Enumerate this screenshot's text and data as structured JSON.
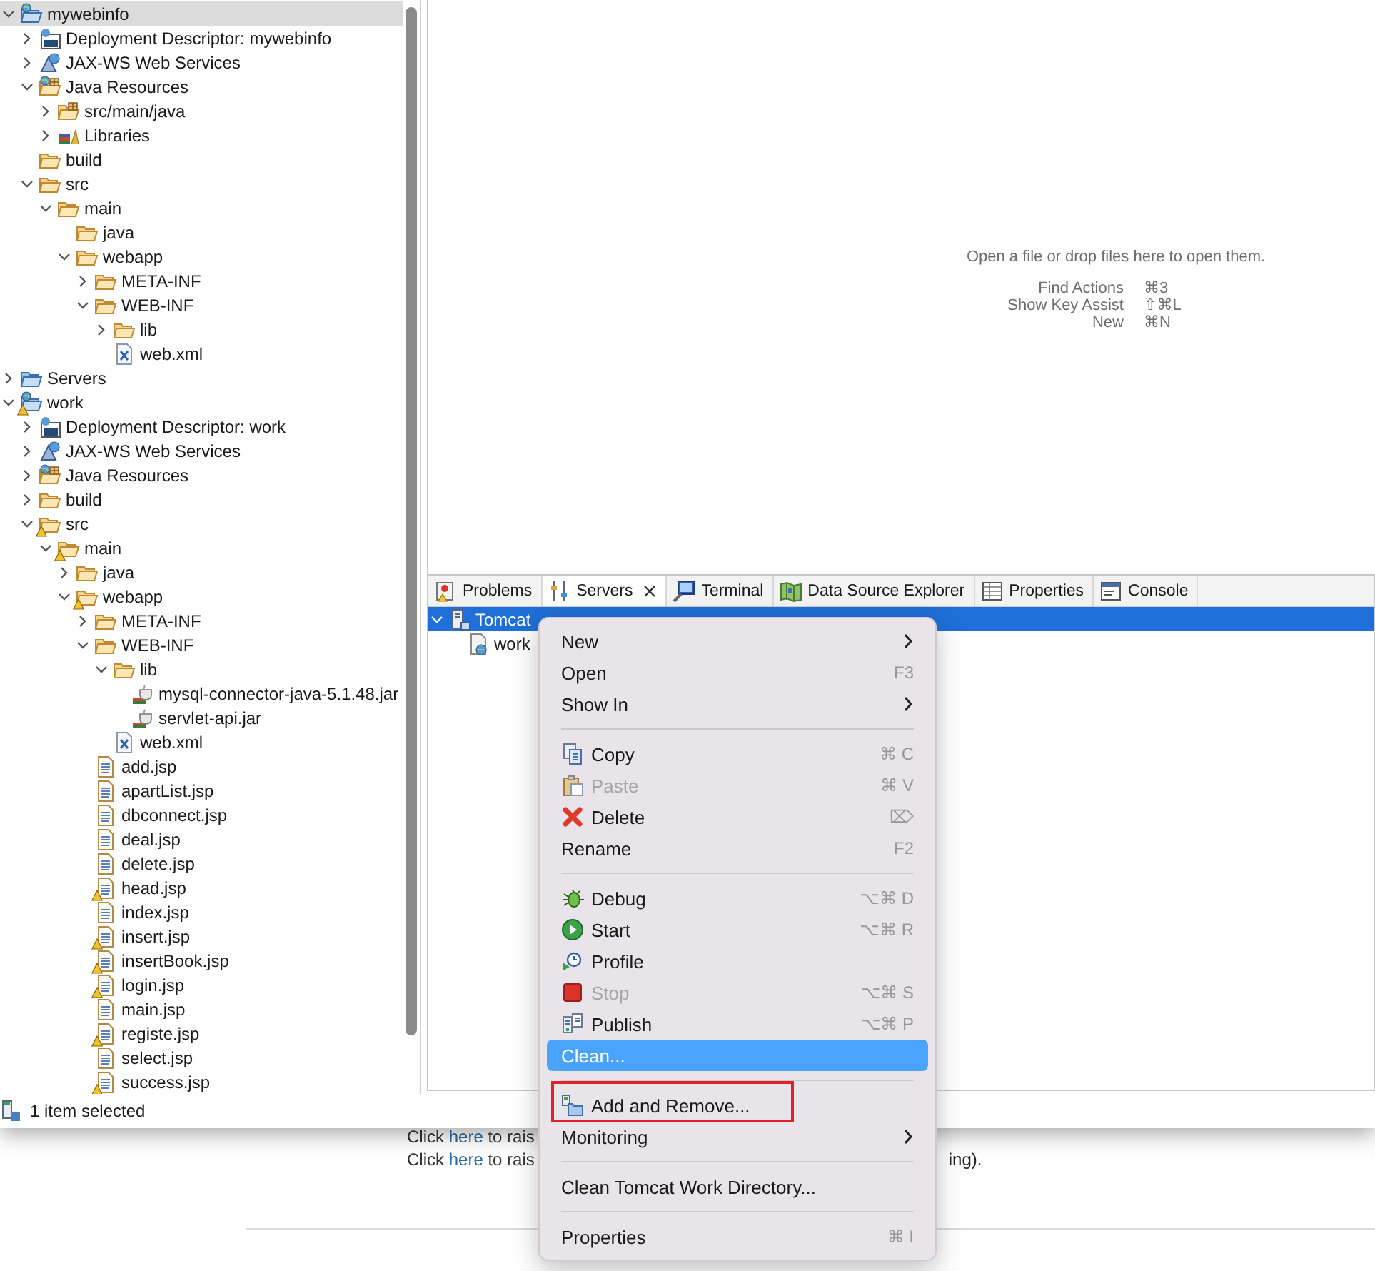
{
  "project_explorer": {
    "items": [
      {
        "label": "mywebinfo",
        "kind": "project",
        "expanded": true,
        "selected": true,
        "warning": false,
        "children": [
          {
            "label": "Deployment Descriptor: mywebinfo",
            "kind": "descriptor",
            "expanded": false,
            "selected": false,
            "warning": false
          },
          {
            "label": "JAX-WS Web Services",
            "kind": "webservices",
            "expanded": false,
            "selected": false,
            "warning": false
          },
          {
            "label": "Java Resources",
            "kind": "javaresources",
            "expanded": true,
            "selected": false,
            "warning": false,
            "children": [
              {
                "label": "src/main/java",
                "kind": "package",
                "expanded": false,
                "selected": false,
                "warning": false
              },
              {
                "label": "Libraries",
                "kind": "libraries",
                "expanded": false,
                "selected": false,
                "warning": false
              }
            ]
          },
          {
            "label": "build",
            "kind": "folder",
            "selected": false,
            "warning": false
          },
          {
            "label": "src",
            "kind": "folder",
            "expanded": true,
            "selected": false,
            "warning": false,
            "children": [
              {
                "label": "main",
                "kind": "folder",
                "expanded": true,
                "selected": false,
                "warning": false,
                "children": [
                  {
                    "label": "java",
                    "kind": "folder",
                    "selected": false,
                    "warning": false
                  },
                  {
                    "label": "webapp",
                    "kind": "folder",
                    "expanded": true,
                    "selected": false,
                    "warning": false,
                    "children": [
                      {
                        "label": "META-INF",
                        "kind": "folder",
                        "expanded": false,
                        "selected": false,
                        "warning": false
                      },
                      {
                        "label": "WEB-INF",
                        "kind": "folder",
                        "expanded": true,
                        "selected": false,
                        "warning": false,
                        "children": [
                          {
                            "label": "lib",
                            "kind": "folder",
                            "expanded": false,
                            "selected": false,
                            "warning": false
                          },
                          {
                            "label": "web.xml",
                            "kind": "xml",
                            "selected": false,
                            "warning": false
                          }
                        ]
                      }
                    ]
                  }
                ]
              }
            ]
          }
        ]
      },
      {
        "label": "Servers",
        "kind": "serversfolder",
        "expanded": false,
        "selected": false,
        "warning": false
      },
      {
        "label": "work",
        "kind": "project",
        "expanded": true,
        "selected": false,
        "warning": true,
        "children": [
          {
            "label": "Deployment Descriptor: work",
            "kind": "descriptor",
            "expanded": false,
            "selected": false,
            "warning": false
          },
          {
            "label": "JAX-WS Web Services",
            "kind": "webservices",
            "expanded": false,
            "selected": false,
            "warning": false
          },
          {
            "label": "Java Resources",
            "kind": "javaresources",
            "expanded": false,
            "selected": false,
            "warning": false
          },
          {
            "label": "build",
            "kind": "folder",
            "expanded": false,
            "selected": false,
            "warning": false
          },
          {
            "label": "src",
            "kind": "folder",
            "expanded": true,
            "selected": false,
            "warning": true,
            "children": [
              {
                "label": "main",
                "kind": "folder",
                "expanded": true,
                "selected": false,
                "warning": true,
                "children": [
                  {
                    "label": "java",
                    "kind": "folder",
                    "expanded": false,
                    "selected": false,
                    "warning": false
                  },
                  {
                    "label": "webapp",
                    "kind": "folder",
                    "expanded": true,
                    "selected": false,
                    "warning": true,
                    "children": [
                      {
                        "label": "META-INF",
                        "kind": "folder",
                        "expanded": false,
                        "selected": false,
                        "warning": false
                      },
                      {
                        "label": "WEB-INF",
                        "kind": "folder",
                        "expanded": true,
                        "selected": false,
                        "warning": false,
                        "children": [
                          {
                            "label": "lib",
                            "kind": "folder",
                            "expanded": true,
                            "selected": false,
                            "warning": false,
                            "children": [
                              {
                                "label": "mysql-connector-java-5.1.48.jar",
                                "kind": "jar",
                                "selected": false,
                                "warning": false
                              },
                              {
                                "label": "servlet-api.jar",
                                "kind": "jar",
                                "selected": false,
                                "warning": false
                              }
                            ]
                          },
                          {
                            "label": "web.xml",
                            "kind": "xml",
                            "selected": false,
                            "warning": false
                          }
                        ]
                      },
                      {
                        "label": "add.jsp",
                        "kind": "jsp",
                        "selected": false,
                        "warning": false
                      },
                      {
                        "label": "apartList.jsp",
                        "kind": "jsp",
                        "selected": false,
                        "warning": false
                      },
                      {
                        "label": "dbconnect.jsp",
                        "kind": "jsp",
                        "selected": false,
                        "warning": false
                      },
                      {
                        "label": "deal.jsp",
                        "kind": "jsp",
                        "selected": false,
                        "warning": false
                      },
                      {
                        "label": "delete.jsp",
                        "kind": "jsp",
                        "selected": false,
                        "warning": false
                      },
                      {
                        "label": "head.jsp",
                        "kind": "jsp",
                        "selected": false,
                        "warning": true
                      },
                      {
                        "label": "index.jsp",
                        "kind": "jsp",
                        "selected": false,
                        "warning": false
                      },
                      {
                        "label": "insert.jsp",
                        "kind": "jsp",
                        "selected": false,
                        "warning": true
                      },
                      {
                        "label": "insertBook.jsp",
                        "kind": "jsp",
                        "selected": false,
                        "warning": true
                      },
                      {
                        "label": "login.jsp",
                        "kind": "jsp",
                        "selected": false,
                        "warning": true
                      },
                      {
                        "label": "main.jsp",
                        "kind": "jsp",
                        "selected": false,
                        "warning": false
                      },
                      {
                        "label": "registe.jsp",
                        "kind": "jsp",
                        "selected": false,
                        "warning": true
                      },
                      {
                        "label": "select.jsp",
                        "kind": "jsp",
                        "selected": false,
                        "warning": false
                      },
                      {
                        "label": "success.jsp",
                        "kind": "jsp",
                        "selected": false,
                        "warning": true
                      }
                    ]
                  }
                ]
              }
            ]
          }
        ]
      }
    ],
    "status": "1 item selected"
  },
  "editor": {
    "message": "Open a file or drop files here to open them.",
    "key_assists": [
      {
        "action": "Find Actions",
        "keys": "⌘3"
      },
      {
        "action": "Show Key Assist",
        "keys": "⇧⌘L"
      },
      {
        "action": "New",
        "keys": "⌘N"
      }
    ]
  },
  "views": {
    "tabs": [
      {
        "label": "Problems",
        "kind": "problems",
        "selected": false
      },
      {
        "label": "Servers",
        "kind": "servers",
        "selected": true
      },
      {
        "label": "Terminal",
        "kind": "terminal",
        "selected": false
      },
      {
        "label": "Data Source Explorer",
        "kind": "datasource",
        "selected": false
      },
      {
        "label": "Properties",
        "kind": "properties",
        "selected": false
      },
      {
        "label": "Console",
        "kind": "console",
        "selected": false
      }
    ],
    "servers": [
      {
        "label": "Tomcat",
        "kind": "server",
        "expanded": true,
        "selected": true,
        "children": [
          {
            "label": "work",
            "kind": "module",
            "selected": false
          }
        ]
      }
    ]
  },
  "context_menu": [
    {
      "kind": "plain",
      "label": "New",
      "submenu": true,
      "disabled": false,
      "selected": false
    },
    {
      "kind": "plain",
      "label": "Open",
      "shortcut": "F3",
      "submenu": false,
      "disabled": false,
      "selected": false
    },
    {
      "kind": "plain",
      "label": "Show In",
      "submenu": true,
      "disabled": false,
      "selected": false
    },
    {
      "kind": "separator"
    },
    {
      "kind": "copy",
      "label": "Copy",
      "shortcut": "⌘ C",
      "submenu": false,
      "disabled": false,
      "selected": false
    },
    {
      "kind": "paste",
      "label": "Paste",
      "shortcut": "⌘ V",
      "submenu": false,
      "disabled": true,
      "selected": false
    },
    {
      "kind": "delete",
      "label": "Delete",
      "shortcut": "⌦",
      "submenu": false,
      "disabled": false,
      "selected": false
    },
    {
      "kind": "plain",
      "label": "Rename",
      "shortcut": "F2",
      "submenu": false,
      "disabled": false,
      "selected": false
    },
    {
      "kind": "separator"
    },
    {
      "kind": "debug",
      "label": "Debug",
      "shortcut": "⌥⌘ D",
      "submenu": false,
      "disabled": false,
      "selected": false
    },
    {
      "kind": "start",
      "label": "Start",
      "shortcut": "⌥⌘ R",
      "submenu": false,
      "disabled": false,
      "selected": false
    },
    {
      "kind": "profile",
      "label": "Profile",
      "submenu": false,
      "disabled": false,
      "selected": false
    },
    {
      "kind": "stop",
      "label": "Stop",
      "shortcut": "⌥⌘ S",
      "submenu": false,
      "disabled": true,
      "selected": false
    },
    {
      "kind": "publish",
      "label": "Publish",
      "shortcut": "⌥⌘ P",
      "submenu": false,
      "disabled": false,
      "selected": false
    },
    {
      "kind": "plain",
      "label": "Clean...",
      "submenu": false,
      "disabled": false,
      "selected": true
    },
    {
      "kind": "separator"
    },
    {
      "kind": "addremove",
      "label": "Add and Remove...",
      "submenu": false,
      "disabled": false,
      "selected": false,
      "annotated": true
    },
    {
      "kind": "plain",
      "label": "Monitoring",
      "submenu": true,
      "disabled": false,
      "selected": false
    },
    {
      "kind": "separator"
    },
    {
      "kind": "plain",
      "label": "Clean Tomcat Work Directory...",
      "submenu": false,
      "disabled": false,
      "selected": false
    },
    {
      "kind": "separator"
    },
    {
      "kind": "plain",
      "label": "Properties",
      "shortcut": "⌘ I",
      "submenu": false,
      "disabled": false,
      "selected": false
    }
  ],
  "page_behind": {
    "lines": [
      {
        "before": "Click ",
        "link": "here",
        "after": " to rais"
      },
      {
        "before": "Click ",
        "link": "here",
        "after": " to rais"
      }
    ],
    "fragment": "ing)."
  }
}
